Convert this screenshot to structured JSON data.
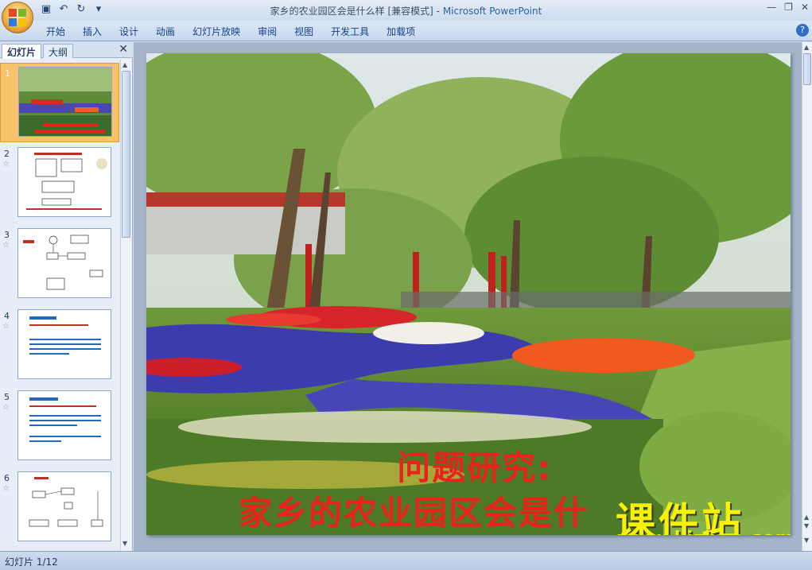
{
  "window": {
    "title": "家乡的农业园区会是什么样 [兼容模式]",
    "app": "Microsoft PowerPoint",
    "separator": " - "
  },
  "ribbon": {
    "tabs": [
      "开始",
      "插入",
      "设计",
      "动画",
      "幻灯片放映",
      "审阅",
      "视图",
      "开发工具",
      "加载项"
    ]
  },
  "panel": {
    "tab_slides": "幻灯片",
    "tab_outline": "大纲",
    "slides": [
      {
        "num": "1"
      },
      {
        "num": "2"
      },
      {
        "num": "3"
      },
      {
        "num": "4"
      },
      {
        "num": "5"
      },
      {
        "num": "6"
      }
    ]
  },
  "slide": {
    "title_line1": "问题研究:",
    "title_line2": "家乡的农业园区会是什",
    "watermark_main": "课件站",
    "watermark_url": "www.kjzhan.com"
  },
  "status": {
    "slide_counter": "幻灯片 1/12"
  },
  "colors": {
    "title_red": "#e8221c",
    "watermark_yellow": "#f7f200",
    "selection_orange": "#f7c26a"
  }
}
